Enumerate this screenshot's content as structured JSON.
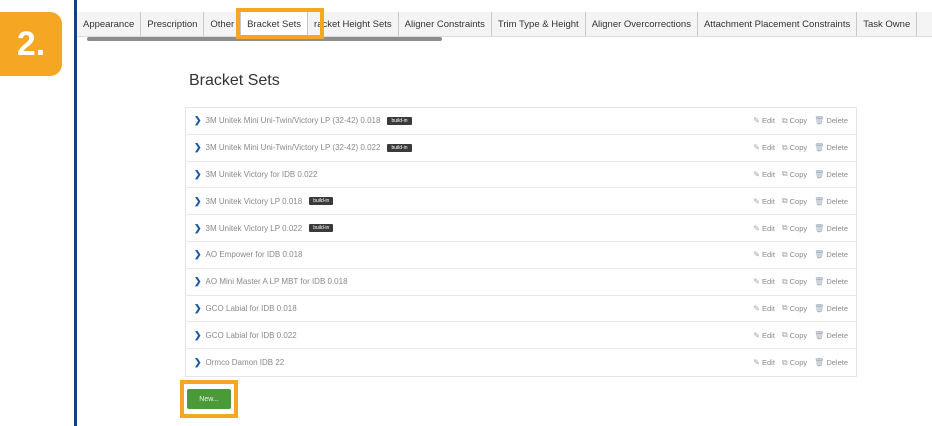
{
  "step_badge": "2.",
  "tabs": [
    {
      "label": "Appearance"
    },
    {
      "label": "Prescription"
    },
    {
      "label": "Other"
    },
    {
      "label": "Bracket Sets"
    },
    {
      "label": "racket Height Sets"
    },
    {
      "label": "Aligner Constraints"
    },
    {
      "label": "Trim Type & Height"
    },
    {
      "label": "Aligner Overcorrections"
    },
    {
      "label": "Attachment Placement Constraints"
    },
    {
      "label": "Task Owne"
    }
  ],
  "heading": "Bracket Sets",
  "actions": {
    "edit": "Edit",
    "copy": "Copy",
    "delete": "Delete"
  },
  "items": [
    {
      "name": "3M Unitek Mini Uni-Twin/Victory LP (32-42) 0.018",
      "badge": "build-in"
    },
    {
      "name": "3M Unitek Mini Uni-Twin/Victory LP (32-42) 0.022",
      "badge": "build-in"
    },
    {
      "name": "3M Unitek Victory for IDB 0.022",
      "badge": ""
    },
    {
      "name": "3M Unitek Victory LP 0.018",
      "badge": "build-in"
    },
    {
      "name": "3M Unitek Victory LP 0.022",
      "badge": "build-in"
    },
    {
      "name": "AO Empower for IDB 0.018",
      "badge": ""
    },
    {
      "name": "AO Mini Master A LP MBT for IDB 0.018",
      "badge": ""
    },
    {
      "name": "GCO Labial for IDB 0.018",
      "badge": ""
    },
    {
      "name": "GCO Labial for IDB 0.022",
      "badge": ""
    },
    {
      "name": "Ormco Damon IDB 22",
      "badge": ""
    }
  ],
  "new_button": "New..."
}
